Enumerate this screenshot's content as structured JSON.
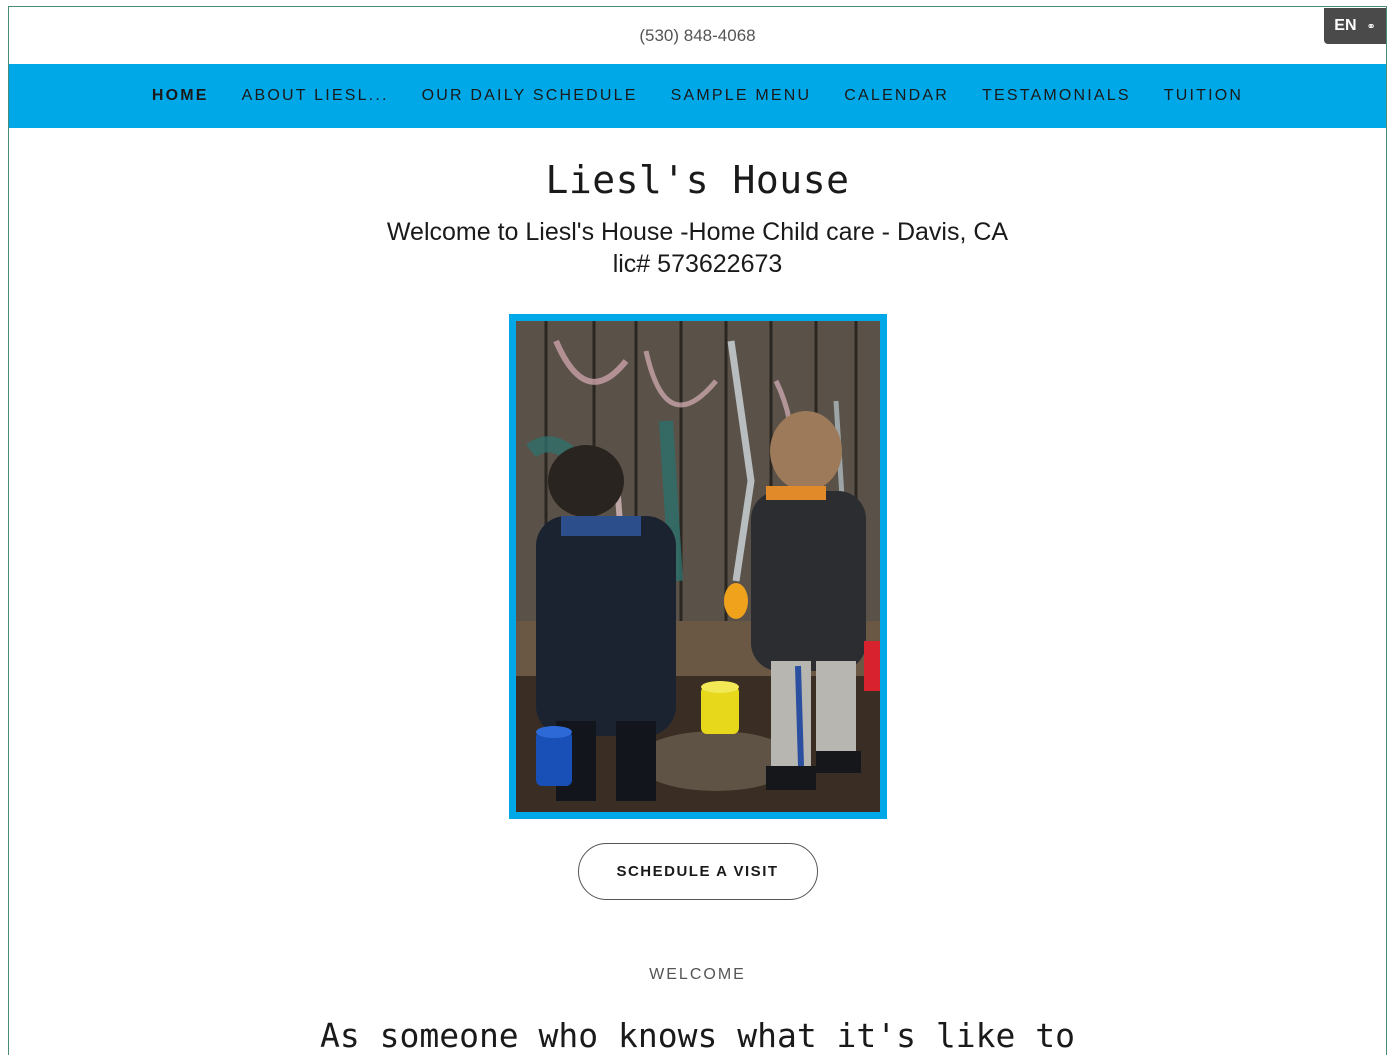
{
  "header": {
    "phone": "(530) 848-4068",
    "language": "EN"
  },
  "nav": {
    "items": [
      {
        "label": "HOME",
        "active": true
      },
      {
        "label": "ABOUT LIESL...",
        "active": false
      },
      {
        "label": "OUR DAILY SCHEDULE",
        "active": false
      },
      {
        "label": "SAMPLE MENU",
        "active": false
      },
      {
        "label": "CALENDAR",
        "active": false
      },
      {
        "label": "TESTAMONIALS",
        "active": false
      },
      {
        "label": "TUITION",
        "active": false
      }
    ]
  },
  "hero": {
    "title": "Liesl's House",
    "subtitle_line1": "Welcome to Liesl's House -Home Child care - Davis, CA",
    "subtitle_line2": "lic# 573622673",
    "cta_label": "SCHEDULE A VISIT"
  },
  "welcome": {
    "label": "WELCOME",
    "heading": "As someone who knows what it's like to"
  },
  "colors": {
    "accent": "#00a8e8",
    "text": "#1a1a1a",
    "badge": "#4a4a4a"
  }
}
